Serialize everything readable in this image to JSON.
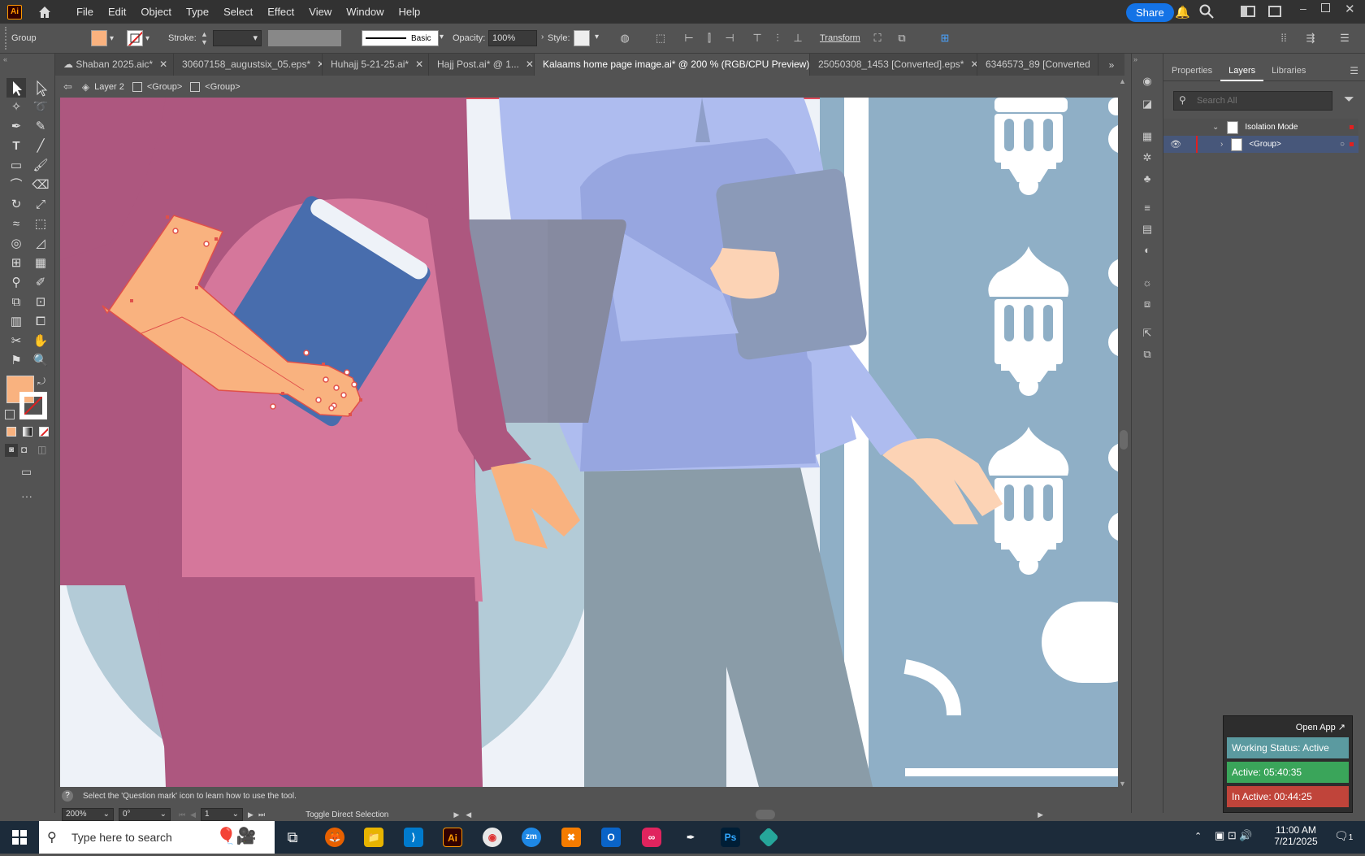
{
  "menubar": {
    "items": [
      "File",
      "Edit",
      "Object",
      "Type",
      "Select",
      "Effect",
      "View",
      "Window",
      "Help"
    ],
    "share": "Share"
  },
  "control": {
    "selection": "Group",
    "fill_color": "#f9b27f",
    "stroke_label": "Stroke:",
    "stroke_profile": "Basic",
    "opacity_label": "Opacity:",
    "opacity_value": "100%",
    "style_label": "Style:",
    "transform": "Transform"
  },
  "tabs": [
    {
      "label": "Shaban 2025.aic*",
      "active": false
    },
    {
      "label": "30607158_augustsix_05.eps*",
      "active": false
    },
    {
      "label": "Huhajj 5-21-25.ai*",
      "active": false
    },
    {
      "label": "Hajj Post.ai* @ 1...",
      "active": false
    },
    {
      "label": "Kalaams home page image.ai* @ 200 % (RGB/CPU Preview)",
      "active": true
    },
    {
      "label": "25050308_1453 [Converted].eps*",
      "active": false
    },
    {
      "label": "6346573_89 [Converted",
      "active": false
    }
  ],
  "breadcrumb": {
    "layer": "Layer 2",
    "group1": "<Group>",
    "group2": "<Group>"
  },
  "panel": {
    "tabs": [
      "Properties",
      "Layers",
      "Libraries"
    ],
    "active_tab": "Layers",
    "search_placeholder": "Search All",
    "rows": [
      {
        "label": "Isolation Mode"
      },
      {
        "label": "<Group>"
      }
    ]
  },
  "status": {
    "hint": "Select the 'Question mark' icon to learn how to use the tool.",
    "zoom": "200%",
    "rotation": "0°",
    "artboard": "1",
    "tool": "Toggle Direct Selection"
  },
  "widget": {
    "open_app": "Open App ↗",
    "working": "Working Status: Active",
    "active": "Active: 05:40:35",
    "inactive": "In Active: 00:44:25",
    "colors": {
      "working": "#5b9aa0",
      "active": "#3aa55a",
      "inactive": "#c0443a"
    }
  },
  "taskbar": {
    "search_placeholder": "Type here to search",
    "time": "11:00 AM",
    "date": "7/21/2025",
    "notif": "1"
  }
}
